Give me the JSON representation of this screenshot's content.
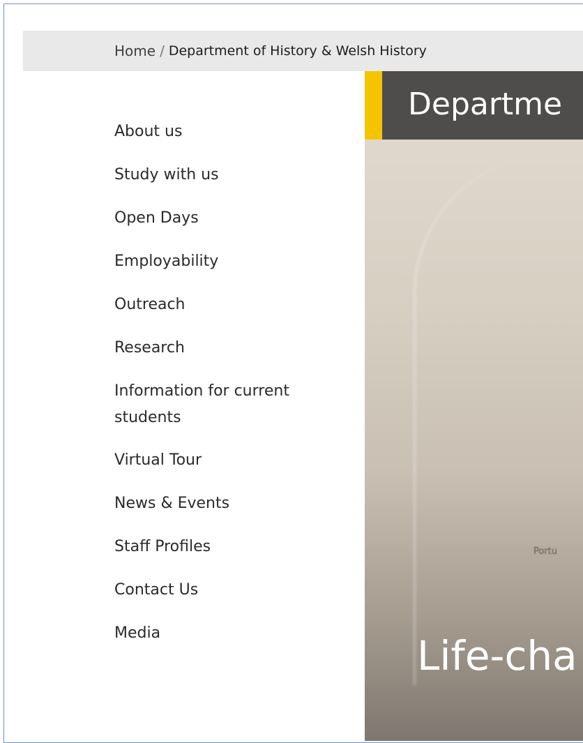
{
  "breadcrumb": {
    "home": "Home",
    "separator": "/",
    "current": "Department of History & Welsh History"
  },
  "sidenav": {
    "items": [
      {
        "label": "About us"
      },
      {
        "label": "Study with us"
      },
      {
        "label": "Open Days"
      },
      {
        "label": "Employability"
      },
      {
        "label": "Outreach"
      },
      {
        "label": "Research"
      },
      {
        "label": "Information for current students"
      },
      {
        "label": "Virtual Tour"
      },
      {
        "label": "News & Events"
      },
      {
        "label": "Staff Profiles"
      },
      {
        "label": "Contact Us"
      },
      {
        "label": "Media"
      }
    ]
  },
  "hero": {
    "title": "Departme",
    "tagline": "Life-cha",
    "map_label": "Portu"
  },
  "colors": {
    "accent": "#f5c400",
    "title_bar": "#4f4d4c",
    "breadcrumb_bg": "#e9e9e9"
  }
}
